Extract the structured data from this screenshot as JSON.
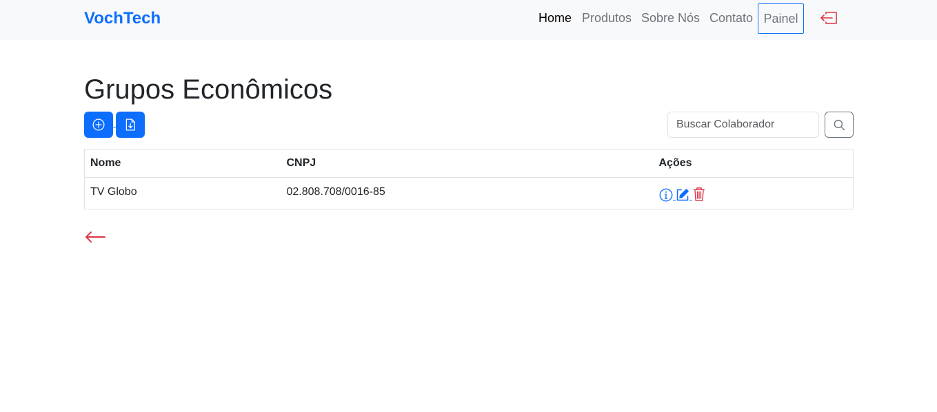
{
  "navbar": {
    "brand": "VochTech",
    "links": [
      {
        "label": "Home",
        "active": true
      },
      {
        "label": "Produtos",
        "active": false
      },
      {
        "label": "Sobre Nós",
        "active": false
      },
      {
        "label": "Contato",
        "active": false
      }
    ],
    "painel_label": "Painel",
    "logout_icon": "box-arrow-left-icon"
  },
  "page": {
    "title": "Grupos Econômicos"
  },
  "toolbar": {
    "add_icon": "plus-circle-icon",
    "export_icon": "file-arrow-down-icon",
    "search": {
      "placeholder": "Buscar Colaborador",
      "value": "",
      "icon": "search-icon"
    }
  },
  "table": {
    "columns": [
      "Nome",
      "CNPJ",
      "Ações"
    ],
    "rows": [
      {
        "nome": "TV Globo",
        "cnpj": "02.808.708/0016-85"
      }
    ],
    "action_icons": [
      "info-circle-icon",
      "pencil-square-icon",
      "trash-icon"
    ]
  },
  "back": {
    "icon": "arrow-left-icon"
  },
  "colors": {
    "primary": "#0d6efd",
    "danger": "#dc3545",
    "navbar_bg": "#f8f9fa",
    "muted": "#6c757d"
  }
}
